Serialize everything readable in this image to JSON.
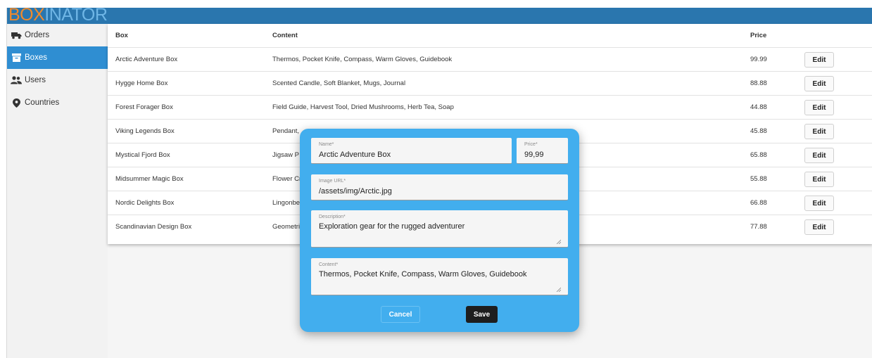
{
  "app": {
    "logo_part1": "BOX",
    "logo_part2": "INATOR"
  },
  "sidebar": {
    "items": [
      {
        "label": "Orders",
        "icon": "truck-icon"
      },
      {
        "label": "Boxes",
        "icon": "archive-box-icon",
        "active": true
      },
      {
        "label": "Users",
        "icon": "users-icon"
      },
      {
        "label": "Countries",
        "icon": "map-pin-icon"
      }
    ]
  },
  "table": {
    "headers": {
      "box": "Box",
      "content": "Content",
      "price": "Price"
    },
    "edit_label": "Edit",
    "rows": [
      {
        "box": "Arctic Adventure Box",
        "content": "Thermos, Pocket Knife, Compass, Warm Gloves, Guidebook",
        "price": "99.99"
      },
      {
        "box": "Hygge Home Box",
        "content": "Scented Candle, Soft Blanket, Mugs, Journal",
        "price": "88.88"
      },
      {
        "box": "Forest Forager Box",
        "content": "Field Guide, Harvest Tool, Dried Mushrooms, Herb Tea, Soap",
        "price": "44.88"
      },
      {
        "box": "Viking Legends Box",
        "content": "Pendant, ",
        "price": "45.88"
      },
      {
        "box": "Mystical Fjord Box",
        "content": "Jigsaw P",
        "price": "65.88"
      },
      {
        "box": "Midsummer Magic Box",
        "content": "Flower Cr",
        "price": "55.88"
      },
      {
        "box": "Nordic Delights Box",
        "content": "Lingonbe",
        "price": "66.88"
      },
      {
        "box": "Scandinavian Design Box",
        "content": "Geometri",
        "price": "77.88"
      }
    ]
  },
  "modal": {
    "name": {
      "label": "Name*",
      "value": "Arctic Adventure Box"
    },
    "price": {
      "label": "Price*",
      "value": "99,99"
    },
    "image_url": {
      "label": "Image URL*",
      "value": "/assets/img/Arctic.jpg"
    },
    "description": {
      "label": "Description*",
      "value": "Exploration gear for the rugged adventurer"
    },
    "content": {
      "label": "Content*",
      "value": "Thermos, Pocket Knife, Compass, Warm Gloves, Guidebook"
    },
    "cancel_label": "Cancel",
    "save_label": "Save"
  },
  "colors": {
    "topbar": "#2a76ae",
    "sidebar_active": "#2f8ed2",
    "modal_bg": "#42aeee",
    "logo_orange": "#ef8a2c",
    "logo_blue": "#6fb6e6"
  }
}
